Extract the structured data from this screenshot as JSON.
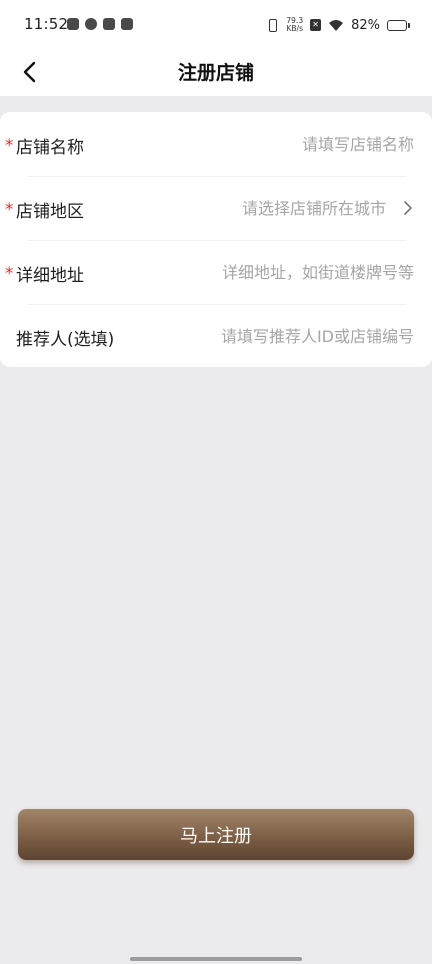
{
  "status_bar": {
    "time": "11:52",
    "speed_value": "79.3",
    "speed_unit": "KB/s",
    "battery_percent": "82%",
    "battery_level": 0.82,
    "icons": [
      "sim-icon",
      "app-icon",
      "app-icon",
      "mail-icon",
      "vibrate-icon",
      "sim-x-icon",
      "wifi-icon",
      "battery-icon"
    ]
  },
  "nav": {
    "title": "注册店铺",
    "back_icon": "chevron-left-icon"
  },
  "form": {
    "fields": [
      {
        "label": "店铺名称",
        "required": true,
        "placeholder": "请填写店铺名称",
        "value": ""
      },
      {
        "label": "店铺地区",
        "required": true,
        "placeholder": "请选择店铺所在城市",
        "value": "",
        "arrow_icon": "chevron-right-icon"
      },
      {
        "label": "详细地址",
        "required": true,
        "placeholder": "详细地址，如街道楼牌号等",
        "value": ""
      },
      {
        "label": "推荐人(选填)",
        "required": false,
        "placeholder": "请填写推荐人ID或店铺编号",
        "value": ""
      }
    ],
    "required_mark": "*"
  },
  "submit": {
    "label": "马上注册"
  },
  "colors": {
    "background": "#ebeaec",
    "card": "#ffffff",
    "required": "#d23b2e",
    "button_top": "#a2866a",
    "button_bottom": "#5e4430",
    "placeholder": "#a6a6a6"
  }
}
